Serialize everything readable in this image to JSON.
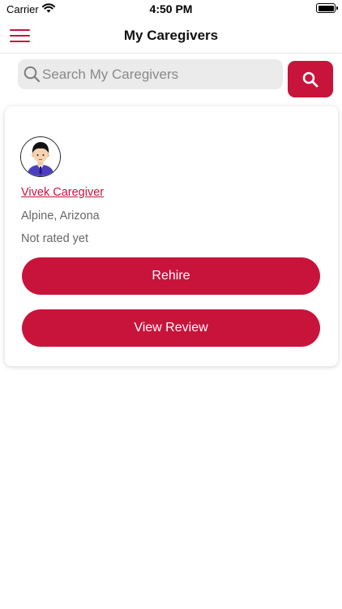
{
  "status_bar": {
    "carrier": "Carrier",
    "time": "4:50 PM",
    "battery_level": 1.0
  },
  "nav": {
    "title": "My Caregivers",
    "menu_icon": "hamburger-menu-icon"
  },
  "search": {
    "placeholder": "Search My Caregivers",
    "value": "",
    "button_icon": "search-icon"
  },
  "caregivers": [
    {
      "avatar_icon": "user-avatar-icon",
      "name": "Vivek Caregiver",
      "location": "Alpine, Arizona",
      "rating_text": "Not rated yet",
      "primary_action": "Rehire",
      "secondary_action": "View Review"
    }
  ],
  "colors": {
    "accent": "#c8143b",
    "search_bg": "#ebebeb",
    "muted_text": "#666666"
  }
}
